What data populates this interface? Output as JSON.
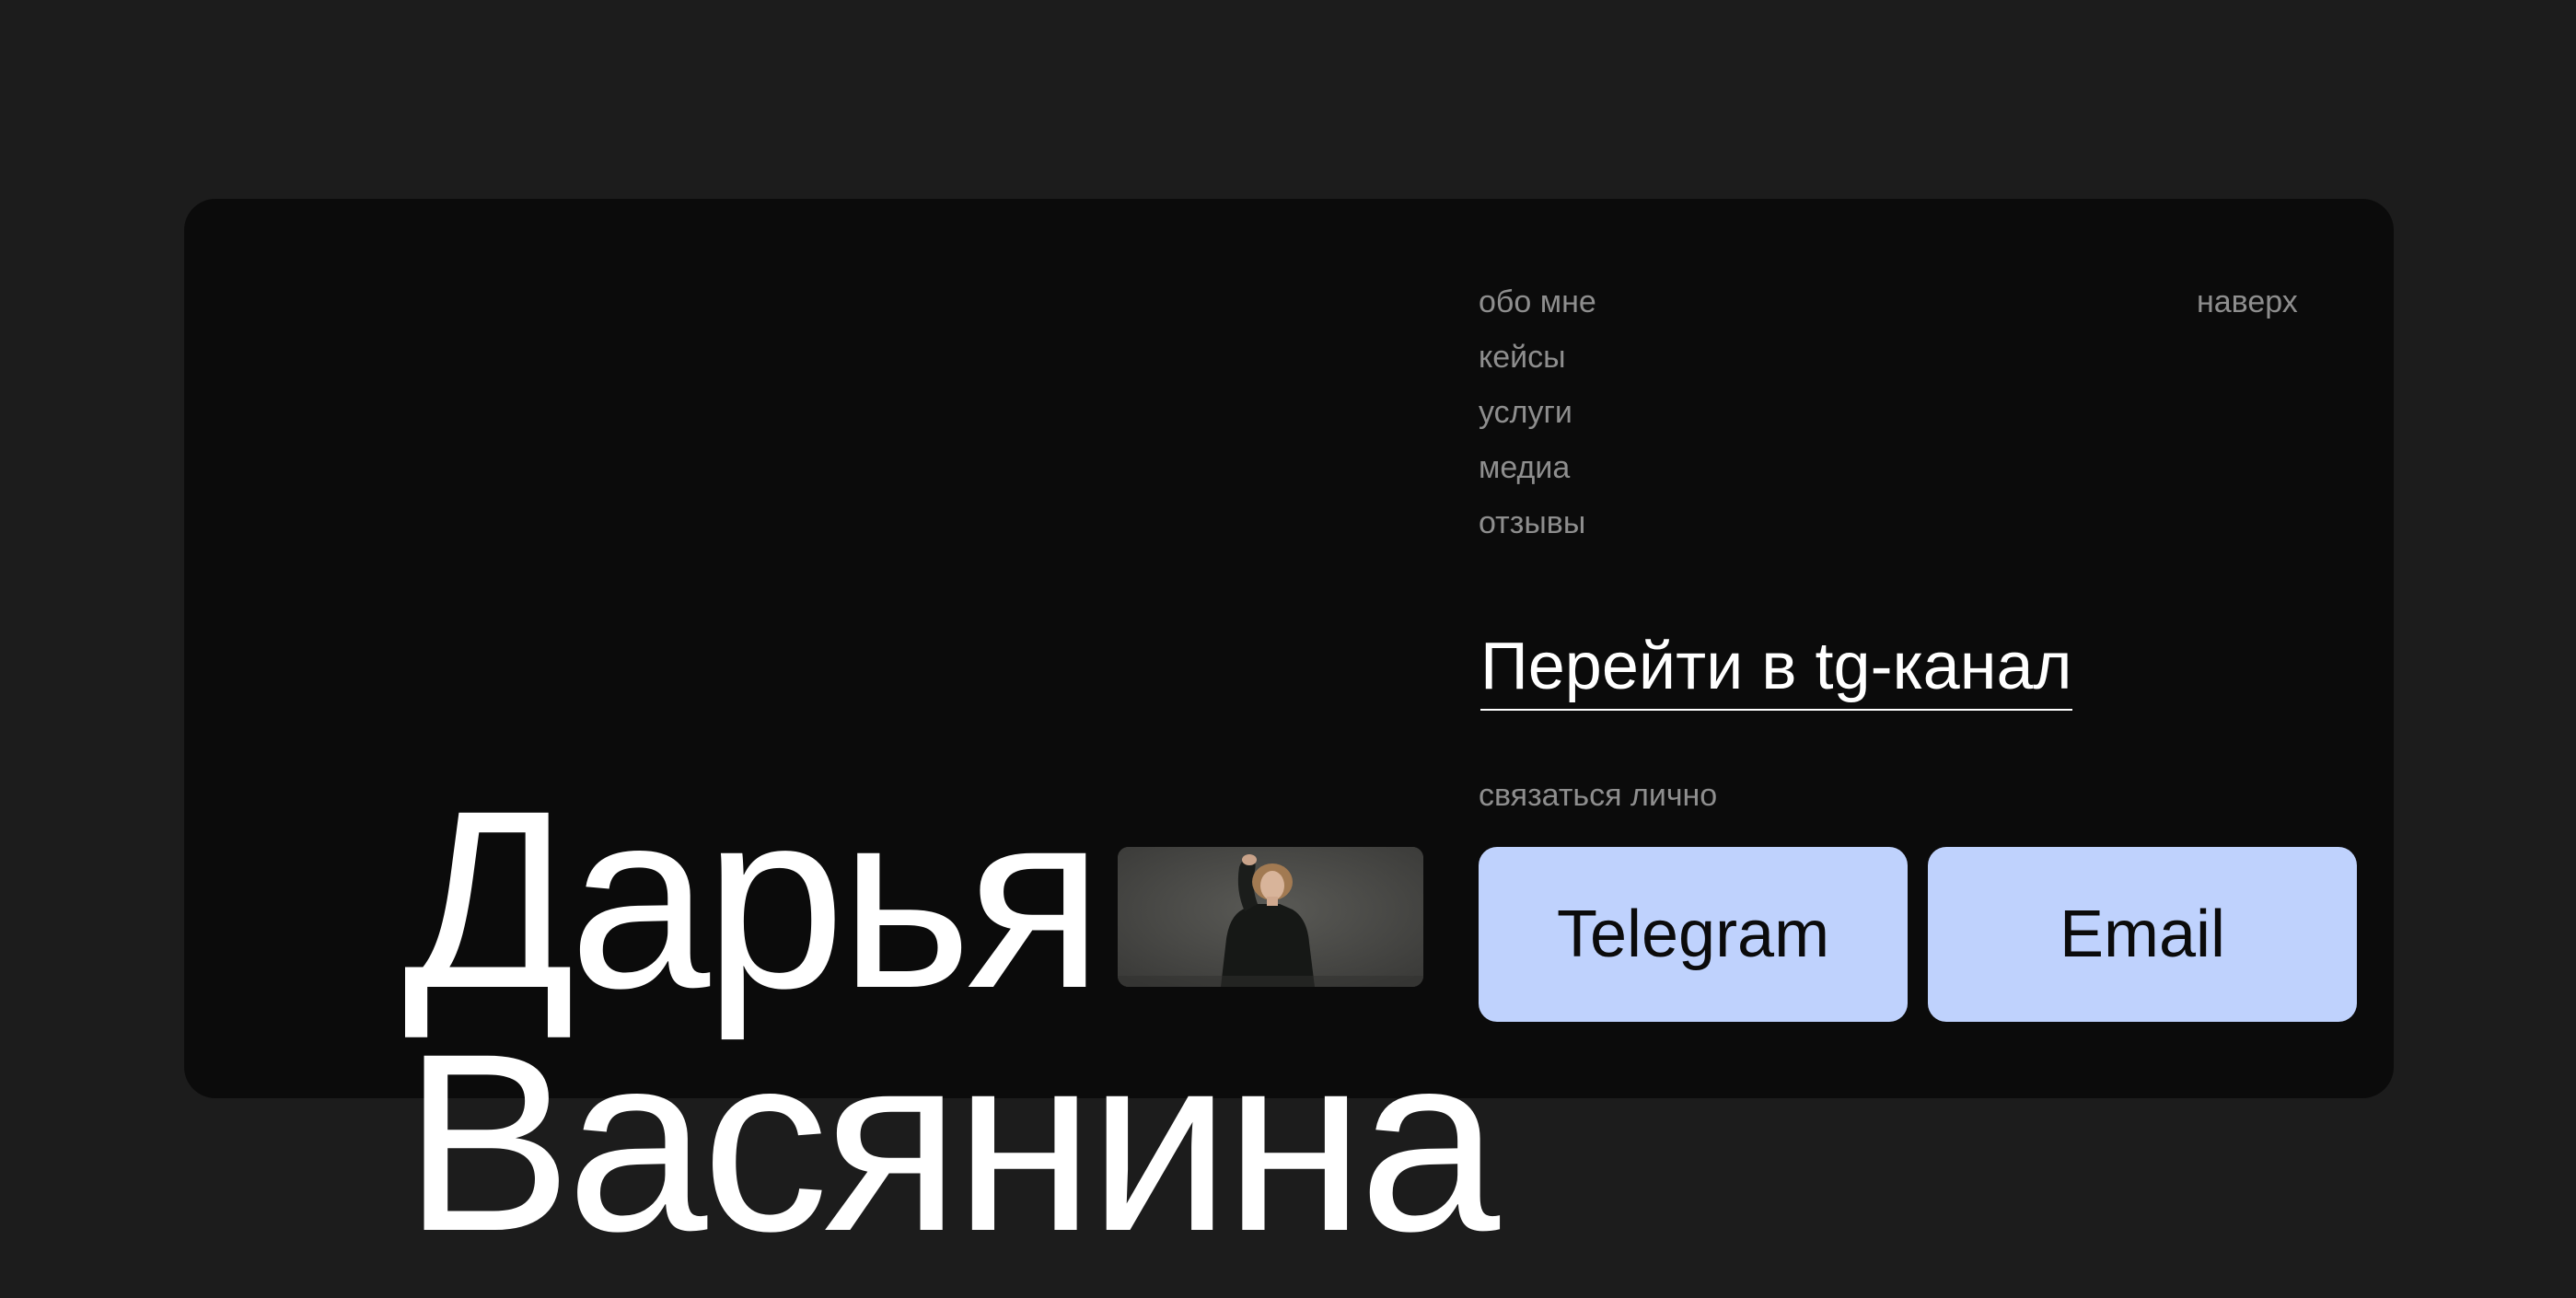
{
  "hero": {
    "first_name": "Дарья",
    "last_name": "Васянина",
    "photo_icon": "portrait-photo"
  },
  "nav": {
    "items": [
      {
        "label": "обо мне"
      },
      {
        "label": "кейсы"
      },
      {
        "label": "услуги"
      },
      {
        "label": "медиа"
      },
      {
        "label": "отзывы"
      }
    ],
    "to_top": "наверх"
  },
  "cta": {
    "tg_link": "Перейти в tg-канал",
    "contact_caption": "связаться лично",
    "telegram_button": "Telegram",
    "email_button": "Email"
  },
  "colors": {
    "page_background": "#1c1c1c",
    "card_background": "#0b0b0b",
    "accent_button": "#bfd2fd",
    "muted_text": "#8e8e8e",
    "primary_text": "#ffffff"
  }
}
